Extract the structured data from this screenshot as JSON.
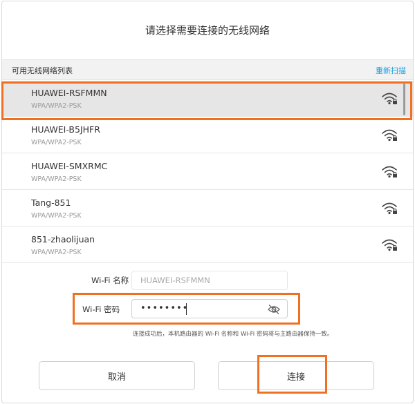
{
  "dialog": {
    "title": "请选择需要连接的无线网络"
  },
  "list": {
    "header_label": "可用无线网络列表",
    "rescan_label": "重新扫描",
    "networks": [
      {
        "ssid": "HUAWEI-RSFMMN",
        "security": "WPA/WPA2-PSK",
        "selected": true,
        "icon": "wifi-locked-icon"
      },
      {
        "ssid": "HUAWEI-B5JHFR",
        "security": "WPA/WPA2-PSK",
        "selected": false,
        "icon": "wifi-locked-icon"
      },
      {
        "ssid": "HUAWEI-SMXRMC",
        "security": "WPA/WPA2-PSK",
        "selected": false,
        "icon": "wifi-locked-icon"
      },
      {
        "ssid": "Tang-851",
        "security": "WPA/WPA2-PSK",
        "selected": false,
        "icon": "wifi-locked-icon"
      },
      {
        "ssid": "851-zhaolijuan",
        "security": "WPA/WPA2-PSK",
        "selected": false,
        "icon": "wifi-locked-icon"
      }
    ]
  },
  "form": {
    "name_label": "Wi-Fi 名称",
    "name_value": "HUAWEI-RSFMMN",
    "password_label": "Wi-Fi 密码",
    "password_masked": "••••••••",
    "password_toggle_icon": "eye-off-icon",
    "note": "连接成功后，本机路由器的 Wi-Fi 名称和 Wi-Fi 密码将与主路由器保持一致。"
  },
  "buttons": {
    "cancel_label": "取消",
    "connect_label": "连接"
  },
  "colors": {
    "highlight": "#f07022",
    "link": "#1ba1e2",
    "selected_row": "#e6e6e6"
  }
}
